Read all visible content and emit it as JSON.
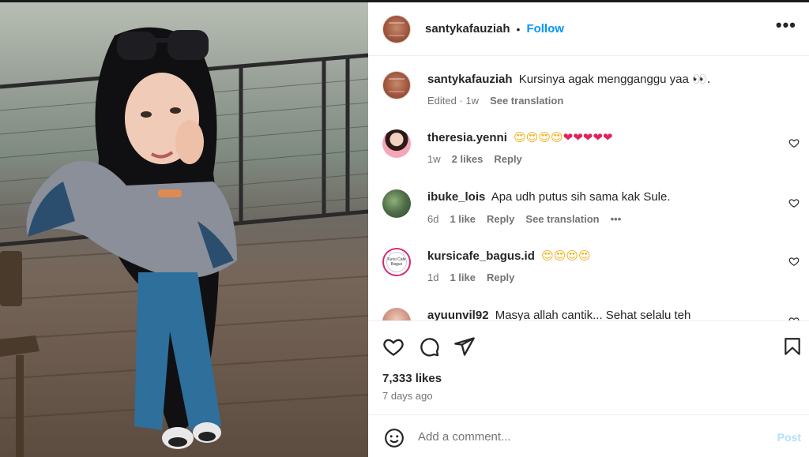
{
  "post": {
    "author": "santykafauziah",
    "follow_label": "Follow",
    "separator": "•",
    "more_label": "•••"
  },
  "caption": {
    "username": "santykafauziah",
    "text": "Kursinya agak mengganggu yaa",
    "emoji": "👀.",
    "edited": "Edited",
    "time": "1w",
    "see_translation": "See translation"
  },
  "comments": [
    {
      "username": "theresia.yenni",
      "text": "",
      "emoji_love": "😍😍😍😍",
      "emoji_hearts": "❤❤❤❤❤",
      "time": "1w",
      "likes": "2 likes",
      "reply": "Reply"
    },
    {
      "username": "ibuke_lois",
      "text": "Apa udh putus sih sama kak Sule.",
      "time": "6d",
      "likes": "1 like",
      "reply": "Reply",
      "see_translation": "See translation",
      "more": "•••"
    },
    {
      "username": "kursicafe_bagus.id",
      "text": "",
      "emoji_love": "😍😍😍😍",
      "avatar_text": "Kursi Cafe Bagus",
      "time": "1d",
      "likes": "1 like",
      "reply": "Reply"
    },
    {
      "username": "ayuunvil92",
      "text": "Masya allah cantik... Sehat selalu teh"
    }
  ],
  "engagement": {
    "likes": "7,333 likes",
    "ago": "7 days ago"
  },
  "add_comment": {
    "placeholder": "Add a comment...",
    "post_label": "Post"
  },
  "colors": {
    "accent": "#0095f6",
    "post_disabled": "#b2dffc",
    "muted": "#737373"
  },
  "icons": [
    "heart-icon",
    "comment-icon",
    "share-icon",
    "bookmark-icon",
    "smiley-icon",
    "more-icon"
  ]
}
